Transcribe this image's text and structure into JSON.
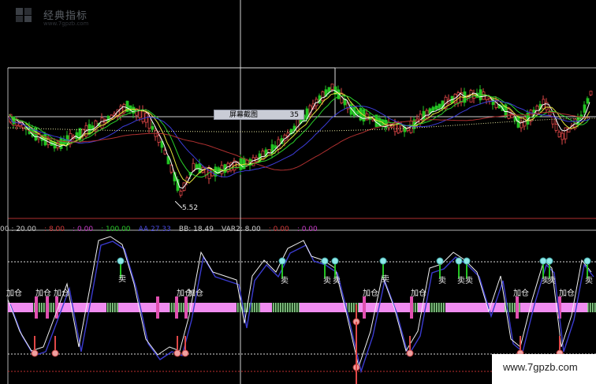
{
  "logo": {
    "title": "经典指标",
    "subtitle": "www.7gpzb.com"
  },
  "screenshot_tip": {
    "label": "屏幕截图",
    "value": "35"
  },
  "price_panel": {
    "low_label": "5.52"
  },
  "indicator_bar": {
    "items": [
      {
        "text": "00 : 20.00",
        "color": "#c8c8c8"
      },
      {
        "text": ": 8.00",
        "color": "#d23b3b"
      },
      {
        "text": ": 0.00",
        "color": "#c83cc8"
      },
      {
        "text": ": 100.00",
        "color": "#2ac92a"
      },
      {
        "text": "AA 27.33",
        "color": "#4a4ae0"
      },
      {
        "text": "BB: 18.49",
        "color": "#d0d0d0"
      },
      {
        "text": "VAR2: 8.00",
        "color": "#d0d0d0"
      },
      {
        "text": ": 0.00",
        "color": "#d23b3b"
      },
      {
        "text": ": 0.00",
        "color": "#c83cc8"
      }
    ]
  },
  "signals": {
    "add_label": "加仓",
    "sell_label": "卖"
  },
  "watermark": {
    "text": "www.7gpzb.com"
  },
  "colors": {
    "up": "#e04848",
    "down": "#23c423",
    "bar_pink": "#f08cf0",
    "ma_white": "#ffffff",
    "ma_yellow": "#e6e63c",
    "ma_green": "#2ad02a",
    "ma_blue": "#3c3cd8",
    "ma_red": "#b03030"
  }
}
